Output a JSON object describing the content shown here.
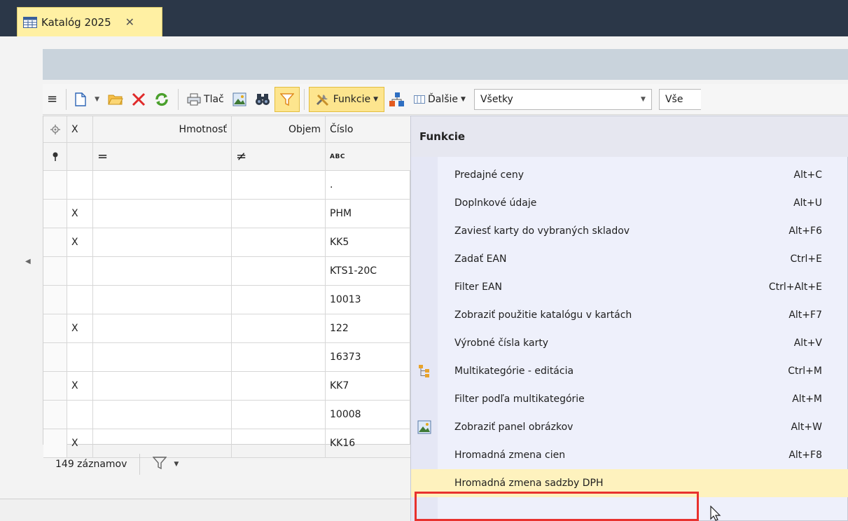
{
  "window": {
    "tab_title": "Katalóg 2025",
    "tab_close": "✕"
  },
  "toolbar": {
    "menu_glyph": "≡",
    "print_label": "Tlač",
    "funkcie_label": "Funkcie",
    "dalsie_label": "Ďalšie",
    "filter_select_value": "Všetky",
    "second_select_value": "Vše"
  },
  "grid": {
    "headers": [
      "",
      "X",
      "Hmotnosť",
      "Objem",
      "Číslo"
    ],
    "filters": [
      "",
      "",
      "=",
      "≠",
      "ABC"
    ],
    "rows": [
      [
        "",
        "",
        "",
        "",
        "."
      ],
      [
        "",
        "X",
        "",
        "",
        "PHM"
      ],
      [
        "",
        "X",
        "",
        "",
        "KK5"
      ],
      [
        "",
        "",
        "",
        "",
        "KTS1-20C"
      ],
      [
        "",
        "",
        "",
        "",
        "10013"
      ],
      [
        "",
        "X",
        "",
        "",
        "122"
      ],
      [
        "",
        "",
        "",
        "",
        "16373"
      ],
      [
        "",
        "X",
        "",
        "",
        "KK7"
      ],
      [
        "",
        "",
        "",
        "",
        "10008"
      ],
      [
        "",
        "X",
        "",
        "",
        "KK16"
      ]
    ]
  },
  "status": {
    "records": "149 záznamov"
  },
  "menu": {
    "header": "Funkcie",
    "items": [
      {
        "label": "Predajné ceny",
        "shortcut": "Alt+C",
        "icon": ""
      },
      {
        "label": "Doplnkové údaje",
        "shortcut": "Alt+U",
        "icon": ""
      },
      {
        "label": "Zaviesť karty do vybraných skladov",
        "shortcut": "Alt+F6",
        "icon": ""
      },
      {
        "label": "Zadať EAN",
        "shortcut": "Ctrl+E",
        "icon": ""
      },
      {
        "label": "Filter EAN",
        "shortcut": "Ctrl+Alt+E",
        "icon": ""
      },
      {
        "label": "Zobraziť použitie katalógu v kartách",
        "shortcut": "Alt+F7",
        "icon": ""
      },
      {
        "label": "Výrobné čísla karty",
        "shortcut": "Alt+V",
        "icon": ""
      },
      {
        "label": "Multikategórie - editácia",
        "shortcut": "Ctrl+M",
        "icon": "tree-icon"
      },
      {
        "label": "Filter podľa multikategórie",
        "shortcut": "Alt+M",
        "icon": ""
      },
      {
        "label": "Zobraziť panel obrázkov",
        "shortcut": "Alt+W",
        "icon": "picture-icon"
      },
      {
        "label": "Hromadná zmena cien",
        "shortcut": "Alt+F8",
        "icon": ""
      },
      {
        "label": "Hromadná zmena sadzby DPH",
        "shortcut": "",
        "icon": ""
      }
    ]
  },
  "colors": {
    "accent": "#fde58e",
    "highlight_border": "#e8312e",
    "tab_bar": "#2b3748"
  }
}
